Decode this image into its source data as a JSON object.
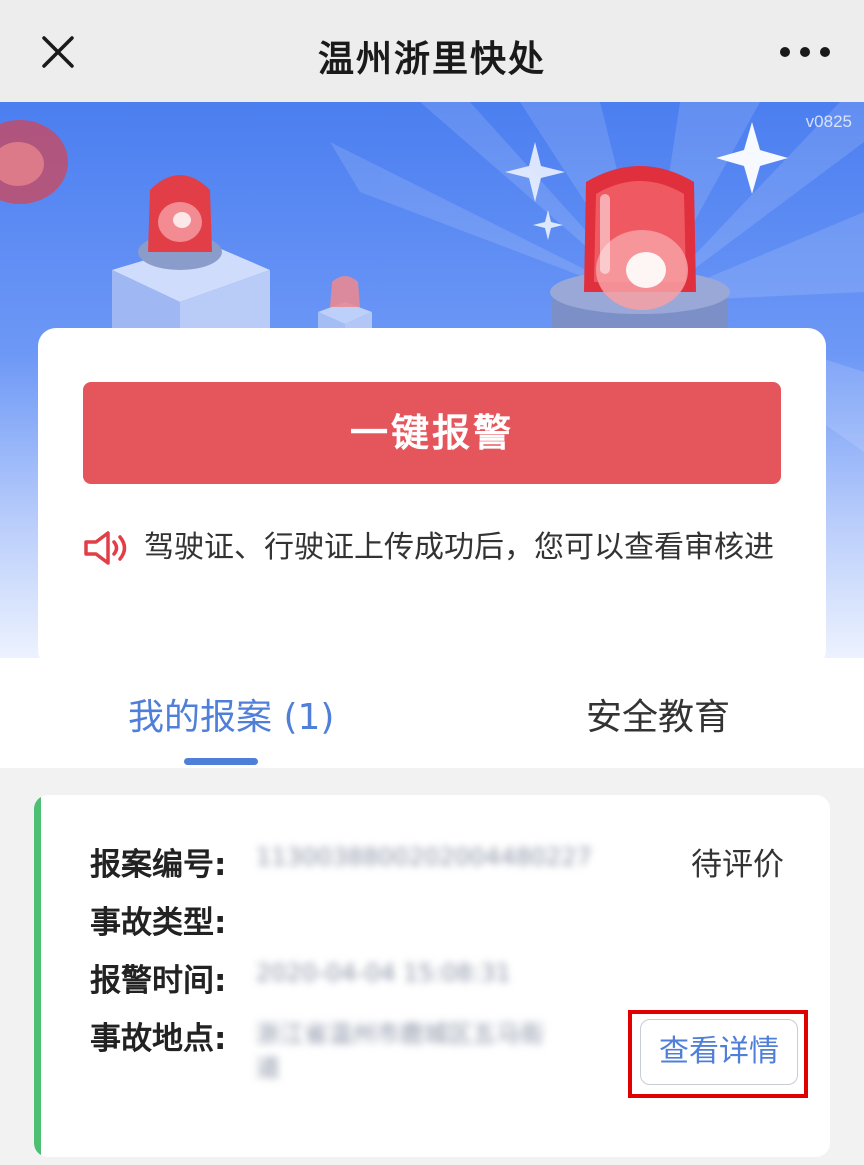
{
  "app": {
    "title": "温州浙里快处",
    "version": "v0825"
  },
  "icons": {
    "close": "close-icon",
    "more": "more-icon",
    "speaker": "speaker-icon"
  },
  "colors": {
    "alarm_button": "#e5555c",
    "accent_blue": "#4f7fd8",
    "status_bar_green": "#4cbf72",
    "highlight_red": "#e00000"
  },
  "main": {
    "alarm_button_label": "一键报警",
    "notice_text": "驾驶证、行驶证上传成功后，您可以查看审核进"
  },
  "tabs": [
    {
      "label": "我的报案 (1)",
      "active": true
    },
    {
      "label": "安全教育",
      "active": false
    }
  ],
  "report": {
    "fields": [
      {
        "label": "报案编号:",
        "value": "1130038800202004480227"
      },
      {
        "label": "事故类型:",
        "value": ""
      },
      {
        "label": "报警时间:",
        "value": "2020-04-04 15:08:31"
      },
      {
        "label": "事故地点:",
        "value": "浙江省温州市鹿城区五马街道"
      }
    ],
    "status": "待评价",
    "detail_button_label": "查看详情"
  }
}
